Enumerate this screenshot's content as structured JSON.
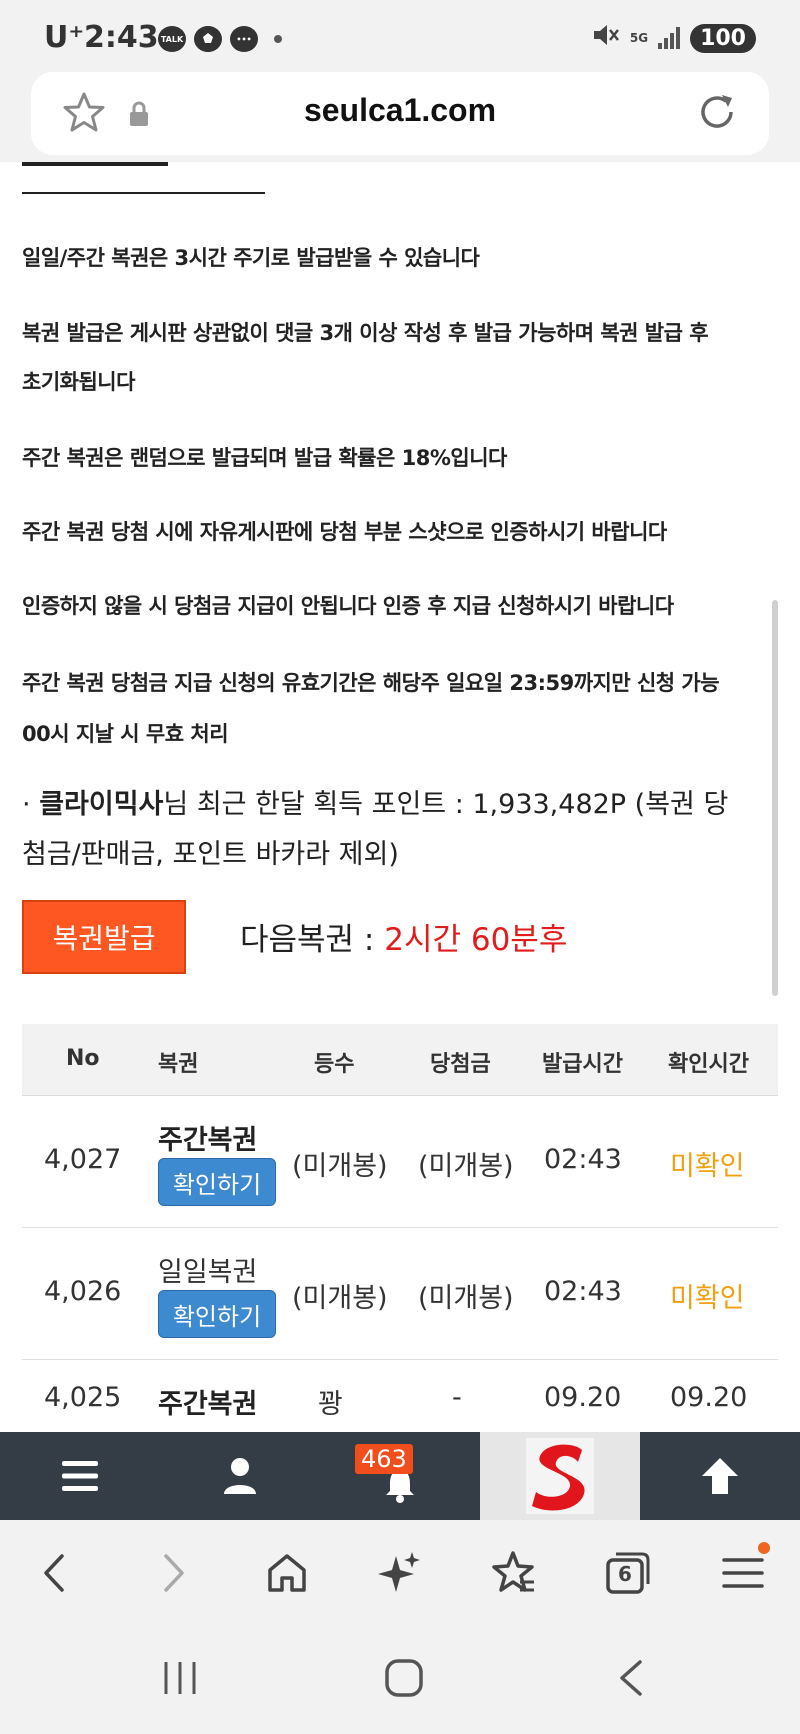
{
  "status_bar": {
    "carrier": "U⁺",
    "time": "2:43",
    "notification_icons": [
      "talk-icon",
      "soccer-icon",
      "chat-icon"
    ],
    "network": "5G",
    "battery": "100"
  },
  "browser": {
    "url": "seulca1.com"
  },
  "rules": [
    "일일/주간 복권은 3시간 주기로 발급받을 수 있습니다",
    "복권 발급은 게시판 상관없이 댓글 3개 이상 작성 후 발급 가능하며 복권 발급 후",
    "초기화됩니다",
    "주간 복권은 랜덤으로 발급되며 발급 확률은 18%입니다",
    "주간 복권 당첨 시에 자유게시판에 당첨 부분 스샷으로 인증하시기 바랍니다",
    "인증하지 않을 시 당첨금 지급이 안됩니다 인증 후 지급 신청하시기 바랍니다",
    "주간 복권 당첨금 지급 신청의 유효기간은 해당주 일요일 23:59까지만 신청 가능",
    "00시 지날 시 무효 처리"
  ],
  "points": {
    "bullet": "·",
    "username": "클라이믹사",
    "line1_rest": "님 최근 한달 획득 포인트 : 1,933,482P (복권 당",
    "line2": "첨금/판매금, 포인트 바카라 제외)"
  },
  "issue_button_label": "복권발급",
  "next_lottery": {
    "label": "다음복권 : ",
    "value": "2시간 60분후"
  },
  "table": {
    "headers": [
      "No",
      "복권",
      "등수",
      "당첨금",
      "발급시간",
      "확인시간"
    ],
    "rows": [
      {
        "no": "4,027",
        "lotto": "주간복권",
        "button": "확인하기",
        "rank": "(미개봉)",
        "prize": "(미개봉)",
        "issued": "02:43",
        "confirmed": "미확인"
      },
      {
        "no": "4,026",
        "lotto": "일일복권",
        "button": "확인하기",
        "rank": "(미개봉)",
        "prize": "(미개봉)",
        "issued": "02:43",
        "confirmed": "미확인"
      },
      {
        "no": "4,025",
        "lotto": "주간복권",
        "button": "",
        "rank": "꽝",
        "prize": "-",
        "issued": "09.20",
        "confirmed": "09.20"
      }
    ]
  },
  "site_nav": {
    "items": [
      "menu-icon",
      "user-icon",
      "bell-icon",
      "logo",
      "arrow-up-icon"
    ],
    "notification_count": "463"
  },
  "browser_nav": {
    "tab_count": "6",
    "items": [
      "back-icon",
      "forward-icon",
      "home-icon",
      "sparkle-icon",
      "bookmarks-icon",
      "tabs-icon",
      "menu-icon"
    ]
  },
  "colors": {
    "accent_orange": "#fe5722",
    "confirm_blue": "#3e8ad1",
    "unconfirmed_amber": "#f0a013",
    "next_red": "#e21c1c",
    "nav_dark": "#343d46"
  }
}
